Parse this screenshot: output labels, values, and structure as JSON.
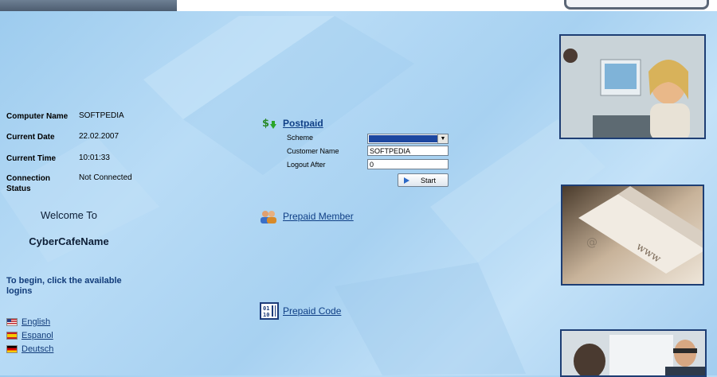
{
  "info": {
    "computer_name_label": "Computer Name",
    "computer_name_value": "SOFTPEDIA",
    "current_date_label": "Current Date",
    "current_date_value": "22.02.2007",
    "current_time_label": "Current Time",
    "current_time_value": "10:01:33",
    "connection_status_label": "Connection Status",
    "connection_status_value": "Not Connected"
  },
  "welcome": {
    "line1": "Welcome To",
    "line2": "CyberCafeName",
    "instruction": "To begin, click the available logins"
  },
  "languages": [
    {
      "label": "English",
      "icon": "us-flag-icon"
    },
    {
      "label": "Espanol",
      "icon": "spain-flag-icon"
    },
    {
      "label": "Deutsch",
      "icon": "germany-flag-icon"
    }
  ],
  "postpaid": {
    "title": "Postpaid",
    "icon": "money-arrow-icon",
    "scheme_label": "Scheme",
    "scheme_value": "",
    "customer_name_label": "Customer Name",
    "customer_name_value": "SOFTPEDIA",
    "logout_after_label": "Logout After",
    "logout_after_value": "0",
    "start_label": "Start"
  },
  "prepaid_member": {
    "title": "Prepaid Member",
    "icon": "users-icon"
  },
  "prepaid_code": {
    "title": "Prepaid Code",
    "icon": "barcode-icon"
  },
  "colors": {
    "link": "#0f3f86",
    "background": "#b0d6f4",
    "photo_border": "#1e3e74"
  }
}
